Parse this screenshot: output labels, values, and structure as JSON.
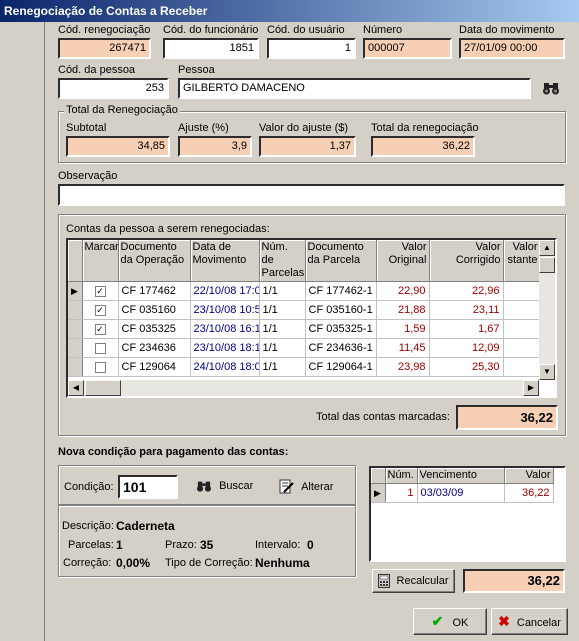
{
  "window": {
    "title": "Renegociação de Contas a Receber"
  },
  "header": {
    "cod_renegociacao": {
      "label": "Cód. renegociação",
      "value": "267471"
    },
    "cod_funcionario": {
      "label": "Cód. do funcionário",
      "value": "1851"
    },
    "cod_usuario": {
      "label": "Cód. do usuário",
      "value": "1"
    },
    "numero": {
      "label": "Número",
      "value": "000007"
    },
    "data_movimento": {
      "label": "Data do movimento",
      "value": "27/01/09 00:00"
    },
    "cod_pessoa": {
      "label": "Cód. da pessoa",
      "value": "253"
    },
    "pessoa": {
      "label": "Pessoa",
      "value": "GILBERTO DAMACENO"
    }
  },
  "total_reneg": {
    "title": "Total da Renegociação",
    "subtotal": {
      "label": "Subtotal",
      "value": "34,85"
    },
    "ajuste": {
      "label": "Ajuste (%)",
      "value": "3,9"
    },
    "valor_ajuste": {
      "label": "Valor do ajuste ($)",
      "value": "1,37"
    },
    "total": {
      "label": "Total da renegociação",
      "value": "36,22"
    }
  },
  "observacao": {
    "label": "Observação",
    "value": ""
  },
  "contas": {
    "title": "Contas da pessoa a serem renegociadas:",
    "columns": [
      "Marcar",
      "Documento da Operação",
      "Data de Movimento",
      "Núm. de Parcelas",
      "Documento da Parcela",
      "Valor Original",
      "Valor Corrigido",
      "Valor stante"
    ],
    "rows": [
      {
        "marcar": true,
        "doc_op": "CF 177462",
        "data": "22/10/08 17:0",
        "parcelas": "1/1",
        "doc_parc": "CF 177462-1",
        "original": "22,90",
        "corrigido": "22,96",
        "restante": ""
      },
      {
        "marcar": true,
        "doc_op": "CF 035160",
        "data": "23/10/08 10:5",
        "parcelas": "1/1",
        "doc_parc": "CF 035160-1",
        "original": "21,88",
        "corrigido": "23,11",
        "restante": ""
      },
      {
        "marcar": true,
        "doc_op": "CF 035325",
        "data": "23/10/08 16:1",
        "parcelas": "1/1",
        "doc_parc": "CF 035325-1",
        "original": "1,59",
        "corrigido": "1,67",
        "restante": ""
      },
      {
        "marcar": false,
        "doc_op": "CF 234636",
        "data": "23/10/08 18:1",
        "parcelas": "1/1",
        "doc_parc": "CF 234636-1",
        "original": "11,45",
        "corrigido": "12,09",
        "restante": ""
      },
      {
        "marcar": false,
        "doc_op": "CF 129064",
        "data": "24/10/08 18:0",
        "parcelas": "1/1",
        "doc_parc": "CF 129064-1",
        "original": "23,98",
        "corrigido": "25,30",
        "restante": ""
      }
    ],
    "total_label": "Total das contas marcadas:",
    "total_value": "36,22"
  },
  "condicao": {
    "title": "Nova condição para pagamento das contas:",
    "label": "Condição:",
    "value": "101",
    "buscar": "Buscar",
    "alterar": "Alterar",
    "descricao_label": "Descrição:",
    "descricao_value": "Caderneta",
    "parcelas_label": "Parcelas:",
    "parcelas_value": "1",
    "prazo_label": "Prazo:",
    "prazo_value": "35",
    "intervalo_label": "Intervalo:",
    "intervalo_value": "0",
    "correcao_label": "Correção:",
    "correcao_value": "0,00%",
    "tipo_correcao_label": "Tipo de Correção:",
    "tipo_correcao_value": "Nenhuma"
  },
  "parcelas": {
    "columns": [
      "Núm.",
      "Vencimento",
      "Valor"
    ],
    "rows": [
      {
        "num": "1",
        "venc": "03/03/09",
        "valor": "36,22"
      }
    ]
  },
  "recalcular": {
    "label": "Recalcular",
    "value": "36,22"
  },
  "buttons": {
    "ok": "OK",
    "cancelar": "Cancelar"
  }
}
